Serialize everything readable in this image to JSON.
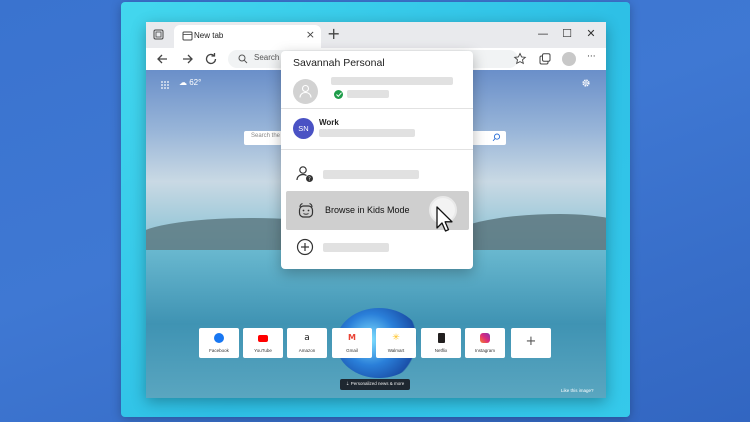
{
  "browser": {
    "tab_title": "New tab",
    "new_tab_symbol": "+",
    "tab_close_symbol": "×",
    "address_placeholder": "Search",
    "window_controls": {
      "minimize": "—",
      "maximize": "☐",
      "close": "✕"
    },
    "menu_dots": "···"
  },
  "new_tab_page": {
    "weather": "62°",
    "search_placeholder": "Search the w",
    "quick_links": [
      {
        "label": "Facebook",
        "color": "#1877f2"
      },
      {
        "label": "YouTube",
        "color": "#ff0000"
      },
      {
        "label": "Amazon",
        "color": "#222222"
      },
      {
        "label": "Gmail",
        "color": "#ea4335"
      },
      {
        "label": "Walmart",
        "color": "#ffc220"
      },
      {
        "label": "Netflix",
        "color": "#e50914"
      },
      {
        "label": "Instagram",
        "color": "#c13584"
      }
    ],
    "add_link_symbol": "+",
    "news_button": "⇣ Personalized news & more",
    "like_image": "Like this image?"
  },
  "profile_menu": {
    "title": "Savannah Personal",
    "work_initials": "SN",
    "work_label": "Work",
    "kids_mode_label": "Browse in Kids Mode"
  },
  "colors": {
    "background": "#3a73cf",
    "frame": "#3ccde9",
    "work_avatar": "#4a52c4",
    "sync_check": "#1f9d4a"
  }
}
